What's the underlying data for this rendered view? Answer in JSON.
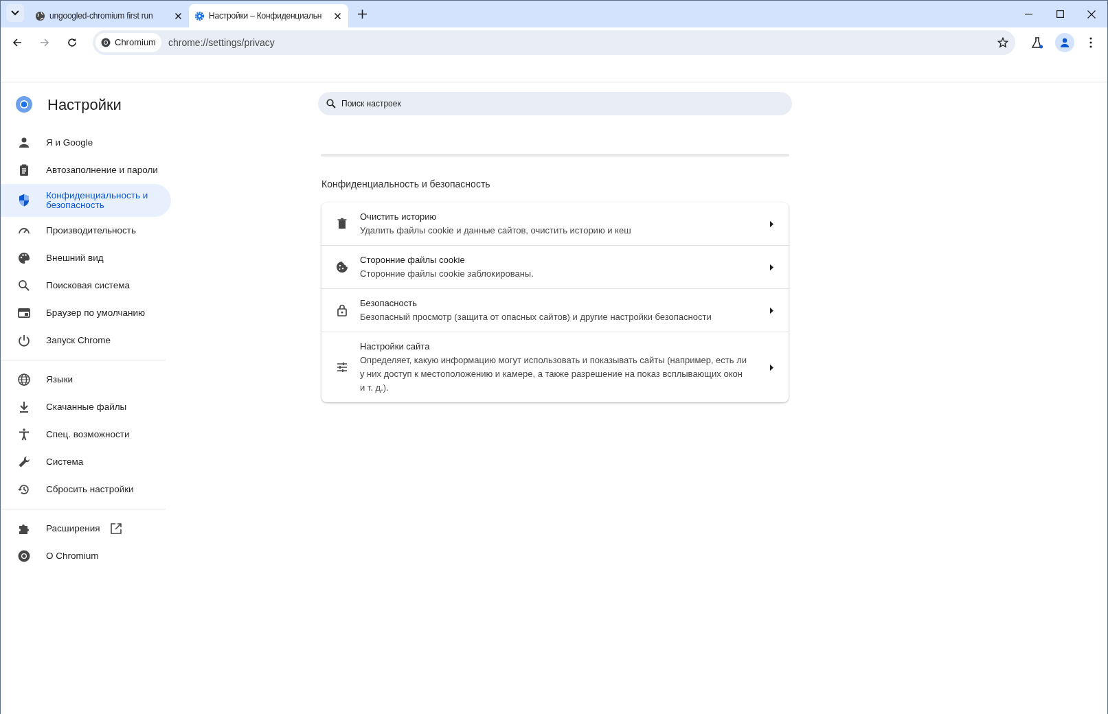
{
  "tabs": [
    {
      "title": "ungoogled-chromium first run",
      "selected": false
    },
    {
      "title": "Настройки – Конфиденциальн",
      "selected": true
    }
  ],
  "address_bar": {
    "chip": "Chromium",
    "url": "chrome://settings/privacy"
  },
  "sidebar": {
    "title": "Настройки",
    "groups": [
      [
        {
          "label": "Я и Google",
          "selected": false,
          "external_link": false
        },
        {
          "label": "Автозаполнение и пароли",
          "selected": false,
          "external_link": false
        },
        {
          "label": "Конфиденциальность и безопасность",
          "selected": true,
          "external_link": false
        },
        {
          "label": "Производительность",
          "selected": false,
          "external_link": false
        },
        {
          "label": "Внешний вид",
          "selected": false,
          "external_link": false
        },
        {
          "label": "Поисковая система",
          "selected": false,
          "external_link": false
        },
        {
          "label": "Браузер по умолчанию",
          "selected": false,
          "external_link": false
        },
        {
          "label": "Запуск Chrome",
          "selected": false,
          "external_link": false
        }
      ],
      [
        {
          "label": "Языки",
          "selected": false,
          "external_link": false
        },
        {
          "label": "Скачанные файлы",
          "selected": false,
          "external_link": false
        },
        {
          "label": "Спец. возможности",
          "selected": false,
          "external_link": false
        },
        {
          "label": "Система",
          "selected": false,
          "external_link": false
        },
        {
          "label": "Сбросить настройки",
          "selected": false,
          "external_link": false
        }
      ],
      [
        {
          "label": "Расширения",
          "selected": false,
          "external_link": true
        },
        {
          "label": "О Chromium",
          "selected": false,
          "external_link": false
        }
      ]
    ]
  },
  "search": {
    "placeholder": "Поиск настроек"
  },
  "section": {
    "title": "Конфиденциальность и безопасность",
    "rows": [
      {
        "title": "Очистить историю",
        "subtitle": "Удалить файлы cookie и данные сайтов, очистить историю и кеш"
      },
      {
        "title": "Сторонние файлы cookie",
        "subtitle": "Сторонние файлы cookie заблокированы."
      },
      {
        "title": "Безопасность",
        "subtitle": "Безопасный просмотр (защита от опасных сайтов) и другие настройки безопасности"
      },
      {
        "title": "Настройки сайта",
        "subtitle": "Определяет, какую информацию могут использовать и показывать сайты (например, есть ли у них доступ к местоположению и камере, а также разрешение на показ всплывающих окон и т. д.)."
      }
    ]
  }
}
